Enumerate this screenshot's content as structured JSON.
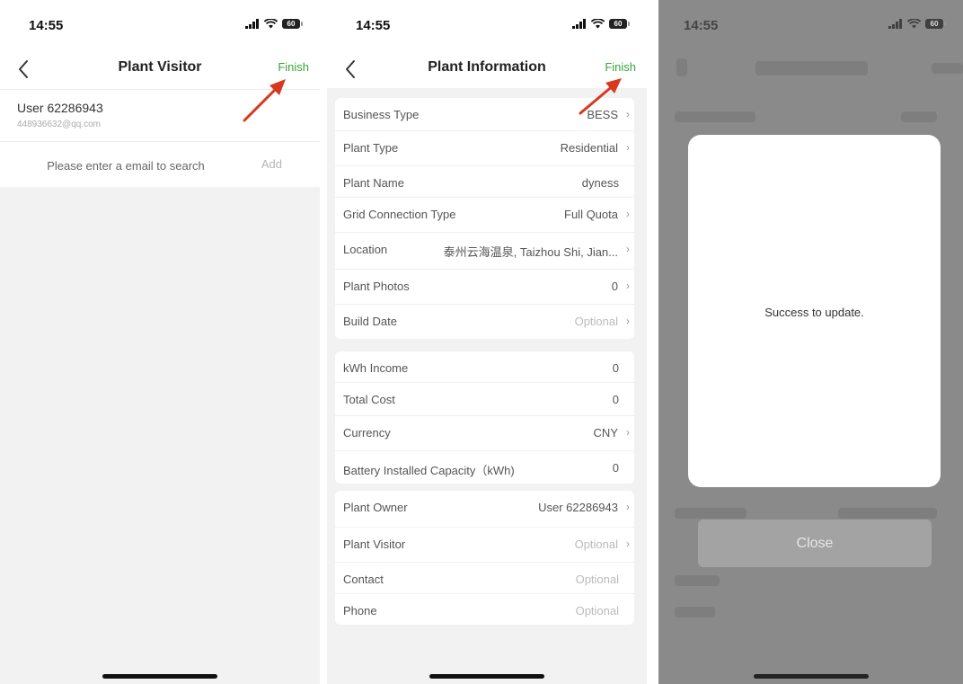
{
  "status_bar": {
    "time": "14:55",
    "battery": "60"
  },
  "panel1": {
    "nav_title": "Plant Visitor",
    "finish_label": "Finish",
    "user": {
      "name": "User 62286943",
      "email": "448936632@qq.com"
    },
    "search": {
      "placeholder": "Please enter a email to search",
      "add_label": "Add"
    }
  },
  "panel2": {
    "nav_title": "Plant Information",
    "finish_label": "Finish",
    "section1": [
      {
        "label": "Business Type",
        "value": "BESS"
      },
      {
        "label": "Plant Type",
        "value": "Residential"
      },
      {
        "label": "Plant Name",
        "value": "dyness"
      },
      {
        "label": "Grid Connection Type",
        "value": "Full Quota"
      },
      {
        "label": "Location",
        "value": "泰州云海温泉, Taizhou Shi, Jian..."
      },
      {
        "label": "Plant Photos",
        "value": "0"
      },
      {
        "label": "Build Date",
        "value": "Optional"
      }
    ],
    "section2": [
      {
        "label": "kWh Income",
        "value": "0"
      },
      {
        "label": "Total Cost",
        "value": "0"
      },
      {
        "label": "Currency",
        "value": "CNY"
      },
      {
        "label": "Battery Installed Capacity（kWh)",
        "value": "0"
      }
    ],
    "section3": [
      {
        "label": "Plant Owner",
        "value": "User 62286943"
      },
      {
        "label": "Plant Visitor",
        "value": "Optional"
      },
      {
        "label": "Contact",
        "value": "Optional"
      },
      {
        "label": "Phone",
        "value": "Optional"
      }
    ]
  },
  "panel3": {
    "message": "Success to update.",
    "close_label": "Close"
  },
  "colors": {
    "accent": "#3aa53a",
    "arrow": "#d9371f"
  }
}
